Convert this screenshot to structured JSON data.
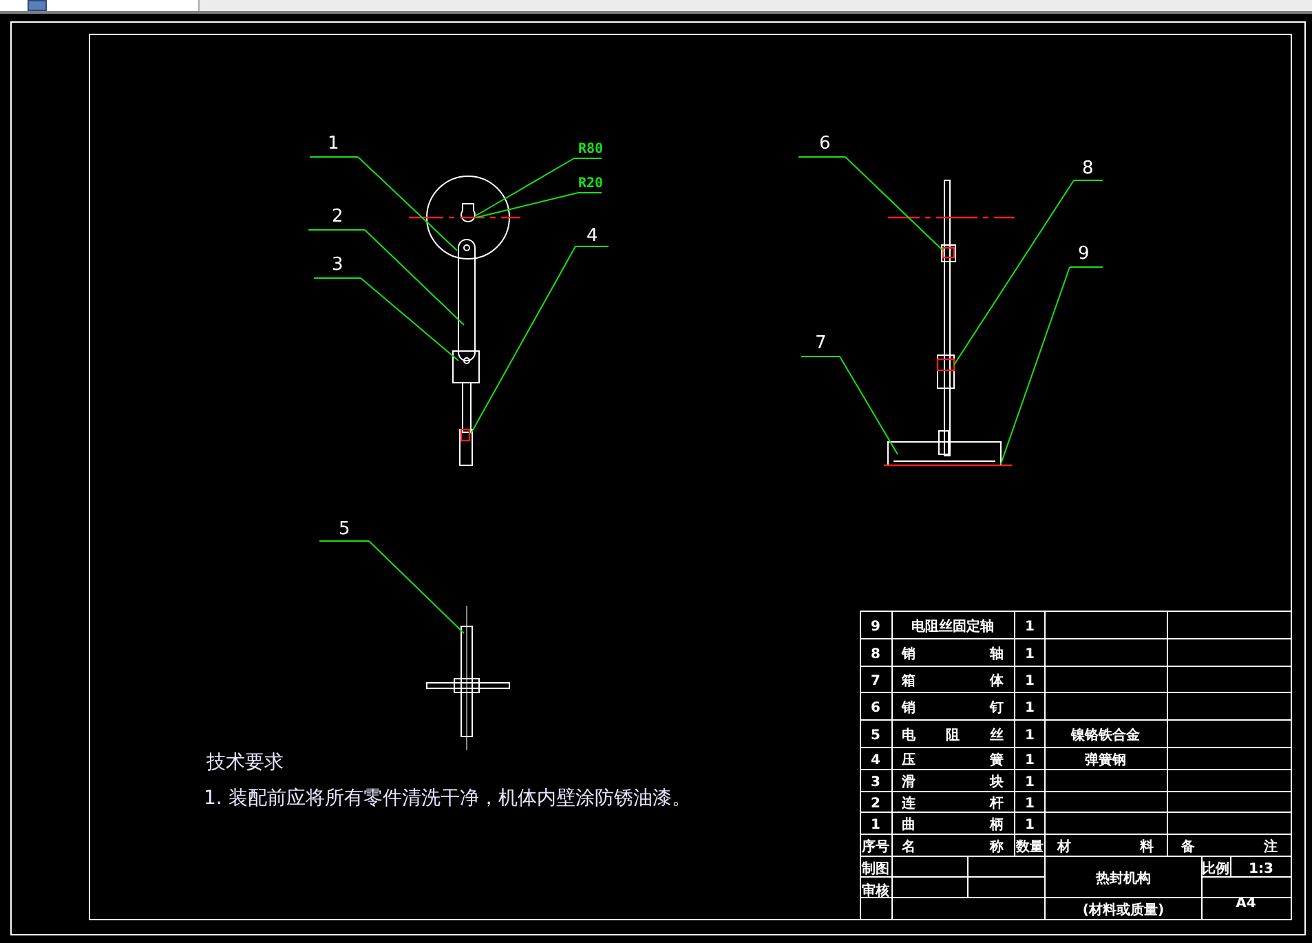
{
  "views": [
    {
      "callouts": [
        {
          "label": "1"
        },
        {
          "label": "R80"
        },
        {
          "label": "R20"
        },
        {
          "label": "2"
        },
        {
          "label": "4"
        },
        {
          "label": "3"
        }
      ]
    },
    {
      "callouts": [
        {
          "label": "6"
        },
        {
          "label": "8"
        },
        {
          "label": "9"
        },
        {
          "label": "7"
        }
      ]
    },
    {
      "callouts": [
        {
          "label": "5"
        }
      ]
    }
  ],
  "technical_requirements": {
    "title": "技术要求",
    "items": [
      "1. 装配前应将所有零件清洗干净，机体内壁涂防锈油漆。"
    ]
  },
  "parts_list": {
    "rows": [
      {
        "no": "9",
        "name": "电阻丝固定轴",
        "qty": "1"
      },
      {
        "no": "8",
        "name": "销 轴",
        "qty": "1"
      },
      {
        "no": "7",
        "name": "箱 体",
        "qty": "1"
      },
      {
        "no": "6",
        "name": "销 钉",
        "qty": "1"
      },
      {
        "no": "5",
        "name": "电 阻 丝",
        "qty": "1",
        "material": "镍铬铁合金"
      },
      {
        "no": "4",
        "name": "压 簧",
        "qty": "1",
        "material": "弹簧钢"
      },
      {
        "no": "3",
        "name": "滑 块",
        "qty": "1"
      },
      {
        "no": "2",
        "name": "连 杆",
        "qty": "1"
      },
      {
        "no": "1",
        "name": "曲 柄",
        "qty": "1"
      }
    ],
    "header": {
      "no": "序号",
      "name": "名 称",
      "qty": "数量",
      "material": "材 料",
      "note": "备 注"
    }
  },
  "title_block": {
    "drawn_by_label": "制图",
    "checked_by_label": "审核",
    "title": "热封机构",
    "subtitle": "(材料或质量)",
    "scale_label": "比例",
    "scale": "1:3",
    "sheet": "A4"
  }
}
